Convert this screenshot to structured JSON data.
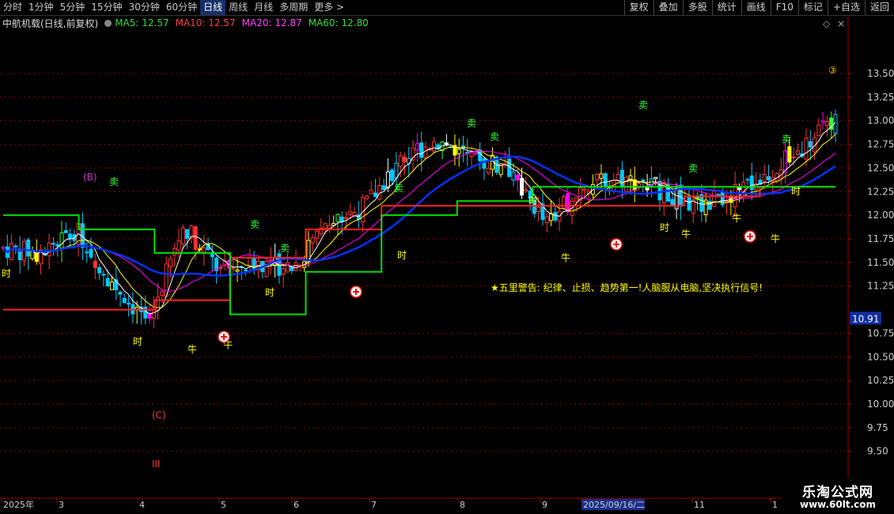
{
  "toolbar": {
    "period_tabs": [
      "分时",
      "1分钟",
      "5分钟",
      "15分钟",
      "30分钟",
      "60分钟",
      "日线",
      "周线",
      "月线",
      "多周期",
      "更多 >"
    ],
    "active_tab": "日线",
    "buttons": [
      "复权",
      "叠加",
      "多股",
      "统计",
      "画线",
      "F10",
      "标记",
      "+自选",
      "返回"
    ]
  },
  "info": {
    "title": "中航机载(日线,前复权)",
    "ma5": "MA5: 12.57",
    "ma10": "MA10: 12.57",
    "ma20": "MA20: 12.87",
    "ma60": "MA60: 12.80"
  },
  "colors": {
    "background": "#000000",
    "up": "#ff3333",
    "down": "#00c8ff",
    "ma5": "#ffffff",
    "ma10": "#ffff00",
    "ma20": "#ff00ff",
    "ma60": "#00ff00",
    "trend": "#0033ff",
    "support": "#ff2020",
    "resist": "#00e000",
    "grid": "#8b0000",
    "sell_text": "#33ff33",
    "buy_text": "#ffff00"
  },
  "warning": "★五里警告: 纪律、止损、趋势第一!人脑服从电脑,坚决执行信号!",
  "price_box": "10.91",
  "axis": {
    "y_ticks": [
      "13.50",
      "13.25",
      "13.00",
      "12.75",
      "12.50",
      "12.25",
      "12.00",
      "11.75",
      "11.50",
      "11.25",
      "10.75",
      "10.50",
      "10.25",
      "10.00",
      "9.75",
      "9.50"
    ],
    "x_labels": [
      "2025年",
      "3",
      "4",
      "5",
      "6",
      "7",
      "8",
      "9",
      "2025/09/16/二",
      "11",
      "1"
    ],
    "x_highlight": "2025/09/16/二"
  },
  "marks": {
    "sell": "卖",
    "buy": "牛",
    "time": "时",
    "wave_b": "(B)",
    "wave_c": "(C)",
    "wave_3": "III",
    "circle_3": "③"
  },
  "logo": {
    "title": "乐淘公式网",
    "url": "www.60lt.com"
  },
  "chart_data": {
    "type": "candlestick",
    "symbol": "中航机载",
    "ylim": [
      9.4,
      13.75
    ],
    "y_tick_values": [
      13.5,
      13.25,
      13.0,
      12.75,
      12.5,
      12.25,
      12.0,
      11.75,
      11.5,
      11.25,
      10.75,
      10.5,
      10.25,
      10.0,
      9.75,
      9.5
    ],
    "current_price": 10.91,
    "support_line": [
      11.0,
      11.0,
      11.1,
      11.55,
      11.85,
      12.1,
      12.1,
      12.1,
      12.1,
      12.2,
      12.3
    ],
    "resistance_line": [
      12.0,
      11.85,
      11.6,
      10.95,
      11.4,
      12.0,
      12.15,
      12.3,
      12.3,
      12.3,
      12.3
    ],
    "approx_close_trend": [
      11.65,
      11.6,
      11.85,
      11.3,
      10.85,
      11.9,
      11.4,
      11.5,
      11.45,
      11.9,
      12.1,
      12.6,
      12.8,
      12.6,
      12.5,
      11.9,
      12.3,
      12.4,
      12.3,
      12.1,
      12.2,
      12.4,
      12.7,
      13.0
    ],
    "annotations": [
      "(B)",
      "(C)",
      "III",
      "③"
    ]
  }
}
